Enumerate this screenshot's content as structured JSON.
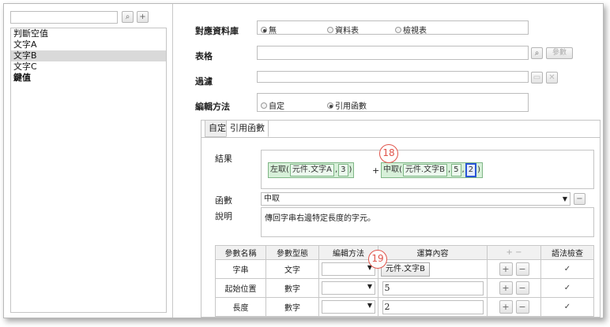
{
  "left_panel": {
    "search_placeholder": "",
    "search_icon_glyph": "⌕",
    "add_icon_glyph": "+",
    "items": [
      {
        "label": "判斷空值",
        "selected": false
      },
      {
        "label": "文字A",
        "selected": false
      },
      {
        "label": "文字B",
        "selected": true
      },
      {
        "label": "文字C",
        "selected": false
      },
      {
        "label": "鍵值",
        "selected": false
      }
    ]
  },
  "form": {
    "db_label": "對應資料庫",
    "db_options": [
      {
        "label": "無",
        "selected": true
      },
      {
        "label": "資料表",
        "selected": false
      },
      {
        "label": "檢視表",
        "selected": false
      }
    ],
    "table_label": "表格",
    "table_value": "",
    "table_search_icon": "⌕",
    "params_button": "參數",
    "filter_label": "過濾",
    "filter_value": "",
    "edit_method_label": "編輯方法",
    "edit_method_options": [
      {
        "label": "自定",
        "selected": false
      },
      {
        "label": "引用函數",
        "selected": true
      }
    ]
  },
  "tabs": [
    {
      "label": "自定",
      "active": false
    },
    {
      "label": "引用函數",
      "active": true
    }
  ],
  "result": {
    "label": "結果",
    "left_func": "左取(",
    "left_arg1": "元件.文字A",
    "left_sep": ",",
    "left_arg2": "3",
    "left_close": ")",
    "plus": "+",
    "mid_func": "中取(",
    "mid_arg1": "元件.文字B",
    "mid_sep1": ",",
    "mid_arg2": "5",
    "mid_sep2": ",",
    "mid_arg3": "2",
    "mid_close": ")",
    "marker_18": "18"
  },
  "function": {
    "label": "函數",
    "value": "中取",
    "collapse_glyph": "−"
  },
  "description": {
    "label": "說明",
    "text": "傳回字串右邊特定長度的字元。"
  },
  "param_table": {
    "headers": [
      "參數名稱",
      "參數型態",
      "編輯方法",
      "運算內容",
      "+  −",
      "語法檢查"
    ],
    "marker_19": "19",
    "rows": [
      {
        "name": "字串",
        "type": "文字",
        "content": "元件.文字B",
        "content_is_chip": true,
        "check": "✓"
      },
      {
        "name": "起始位置",
        "type": "數字",
        "content": "5",
        "content_is_chip": false,
        "check": "✓"
      },
      {
        "name": "長度",
        "type": "數字",
        "content": "2",
        "content_is_chip": false,
        "check": "✓"
      }
    ],
    "plus_glyph": "+",
    "minus_glyph": "−"
  }
}
